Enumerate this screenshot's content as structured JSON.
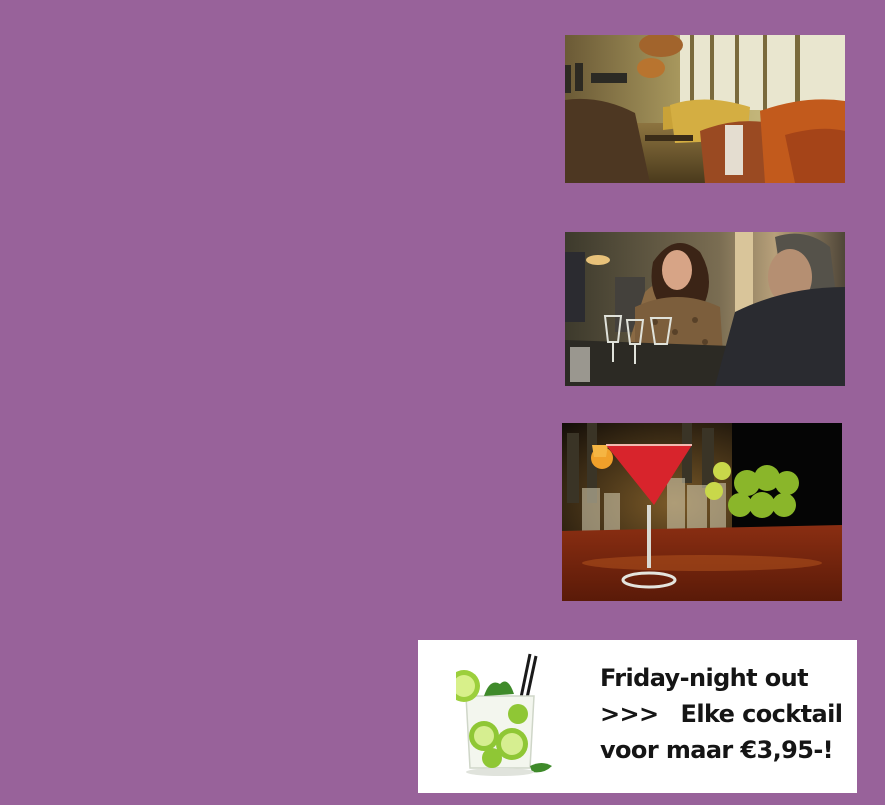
{
  "background_color": "#98629a",
  "photos": [
    {
      "name": "photo-lounge",
      "subject": "hotel lounge interior with orange armchairs and pendant lamps"
    },
    {
      "name": "photo-dinner",
      "subject": "woman and man talking at a restaurant table with wine glasses"
    },
    {
      "name": "photo-cocktail",
      "subject": "red cocktail in a martini glass on a bar with limes"
    }
  ],
  "promo": {
    "image_subject": "mojito glass with lime slices, mint and straws",
    "line1": "Friday-night out",
    "line2_arrows": ">>>",
    "line2_text": "Elke cocktail",
    "line3": "voor maar €3,95-!"
  }
}
